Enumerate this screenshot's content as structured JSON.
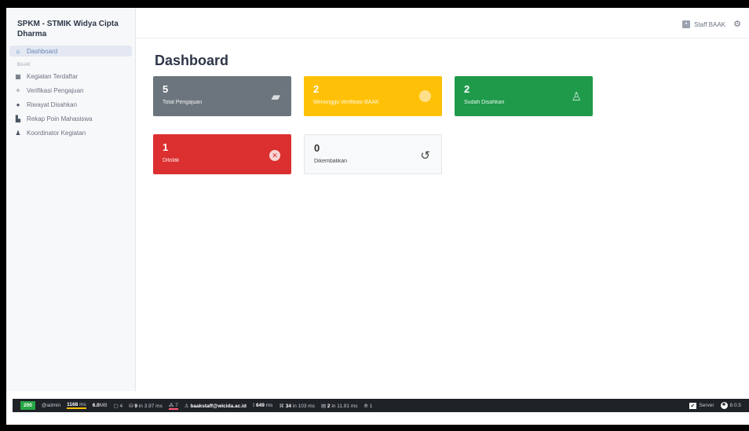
{
  "app": {
    "brand": "SPKM - STMIK Widya Cipta Dharma"
  },
  "sidebar": {
    "items": [
      {
        "label": "Dashboard",
        "icon": "home-icon"
      }
    ],
    "section_label": "BAAK",
    "section_items": [
      {
        "label": "Kegiatan Terdaftar",
        "icon": "calendar-icon"
      },
      {
        "label": "Verifikasi Pengajuan",
        "icon": "check-badge-icon"
      },
      {
        "label": "Riwayat Disahkan",
        "icon": "history-icon"
      },
      {
        "label": "Rekap Poin Mahasiswa",
        "icon": "chart-icon"
      },
      {
        "label": "Koordinator Kegiatan",
        "icon": "user-tie-icon"
      }
    ]
  },
  "topbar": {
    "user_label": "Staff BAAK"
  },
  "main": {
    "title": "Dashboard",
    "cards": [
      {
        "value": "5",
        "label": "Total Pengajuan",
        "icon": "folder-open-icon",
        "color": "#6c757d"
      },
      {
        "value": "2",
        "label": "Menunggu Verifikasi BAAK",
        "icon": "clock-icon",
        "color": "#ffc107"
      },
      {
        "value": "2",
        "label": "Sudah Disahkan",
        "icon": "stamp-icon",
        "color": "#1e9a4a"
      },
      {
        "value": "1",
        "label": "Ditolak",
        "icon": "x-circle-icon",
        "color": "#dc2f2f"
      },
      {
        "value": "0",
        "label": "Dikembalikan",
        "icon": "undo-icon",
        "color": "#f8f9fa"
      }
    ]
  },
  "debugbar": {
    "status": "200",
    "user": "@admin",
    "time": "1168",
    "time_unit": "ms",
    "memory": "6.0",
    "memory_unit": "MB",
    "views": "4",
    "queries": "9",
    "queries_time": "in 3.97 ms",
    "models": "7",
    "auth_user": "baakstaff@wicida.ac.id",
    "route_time": "649",
    "route_unit": "ms",
    "events": "34",
    "events_time": "in 103 ms",
    "cache": "2",
    "cache_time": "in 11.91 ms",
    "gates": "1",
    "server_label": "Server",
    "version": "8.0.5"
  }
}
